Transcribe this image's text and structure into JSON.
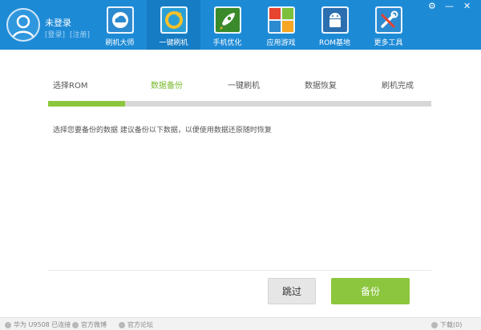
{
  "header": {
    "user": {
      "name": "未登录",
      "login": "[登录]",
      "register": "[注册]"
    },
    "nav": [
      {
        "label": "刷机大师",
        "icon": "cloud-phone-icon"
      },
      {
        "label": "一键刷机",
        "icon": "refresh-icon"
      },
      {
        "label": "手机优化",
        "icon": "rocket-icon"
      },
      {
        "label": "应用游戏",
        "icon": "apps-icon"
      },
      {
        "label": "ROM基地",
        "icon": "android-icon"
      },
      {
        "label": "更多工具",
        "icon": "tools-icon"
      }
    ],
    "active_nav": "一键刷机",
    "window_controls": {
      "settings": "⚙",
      "minimize": "—",
      "close": "✕"
    }
  },
  "steps": {
    "items": [
      "选择ROM",
      "数据备份",
      "一键刷机",
      "数据恢复",
      "刷机完成"
    ],
    "current": "数据备份",
    "progress_fraction": 0.2
  },
  "hint": "选择您要备份的数据  建议备份以下数据，以便使用数据还原随时恢复",
  "buttons": {
    "skip": "跳过",
    "backup": "备份"
  },
  "statusbar": {
    "device": "华为 U9508 已连接",
    "weibo": "官方微博",
    "forum": "官方论坛",
    "download": "下载(0)"
  },
  "colors": {
    "header_bg": "#1d8ad6",
    "accent_green": "#8cc63e",
    "step_active": "#76b72a"
  }
}
